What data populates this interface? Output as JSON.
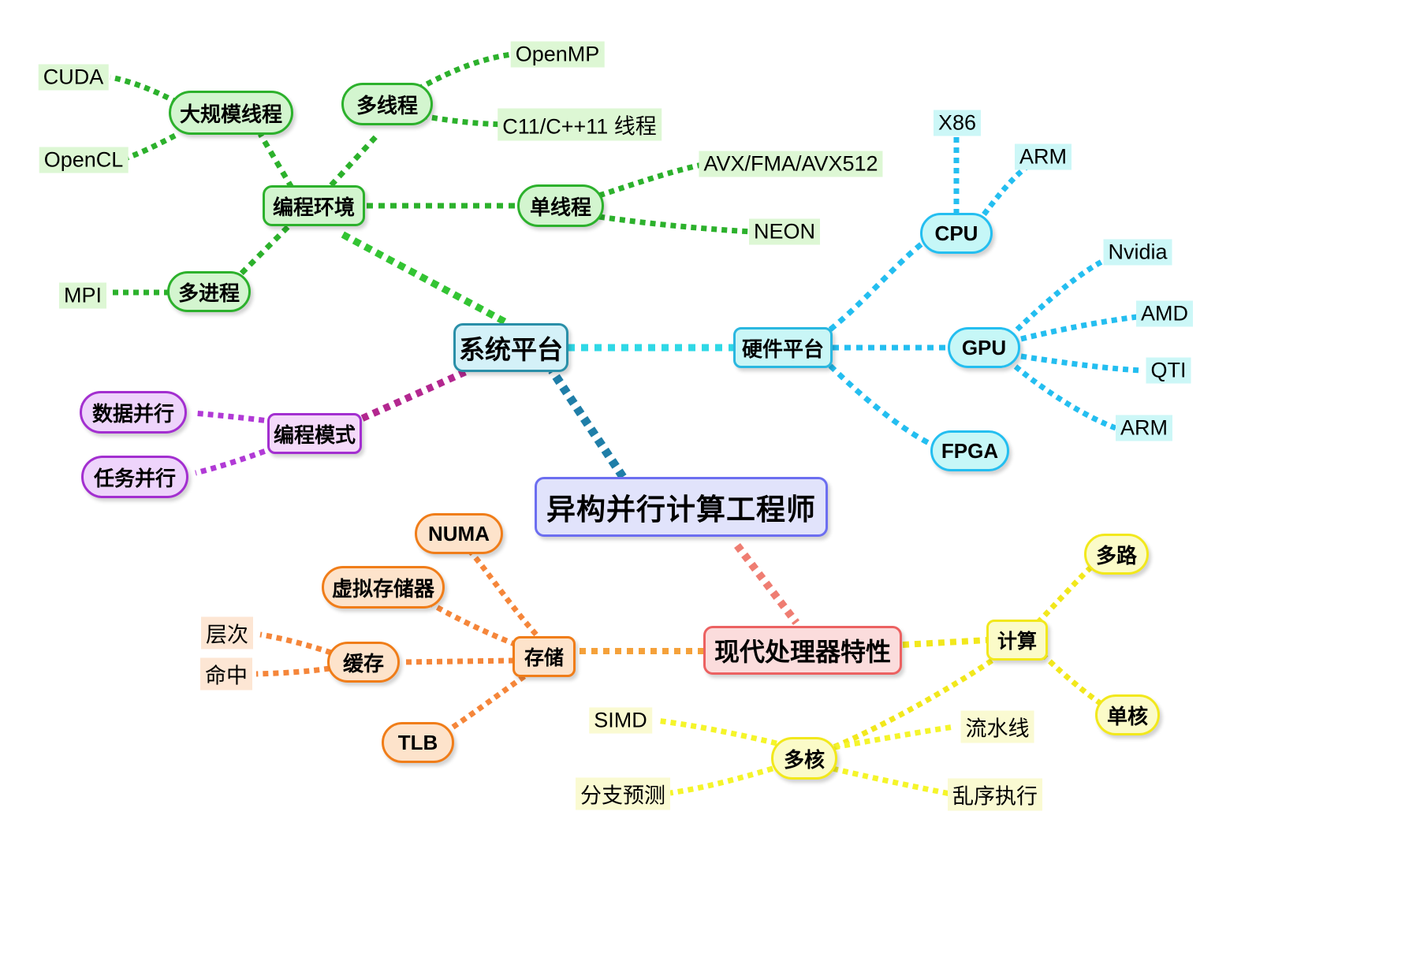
{
  "diagram": {
    "title": "异构并行计算工程师",
    "type": "mind-map",
    "background": "#ffffff"
  },
  "palette": {
    "root": "#6c6ef0",
    "system": "#2a8fa8",
    "programming_env": "#2cb12c",
    "programming_mode": "#a32fd0",
    "hardware": "#24bef0",
    "memory": "#f07d19",
    "processor": "#ec6161",
    "compute": "#f2e81c"
  },
  "root": {
    "label": "异构并行计算工程师"
  },
  "branches": {
    "system_platform": {
      "label": "系统平台",
      "programming_env": {
        "label": "编程环境",
        "children": [
          {
            "label": "大规模线程",
            "leaves": [
              "CUDA",
              "OpenCL"
            ]
          },
          {
            "label": "多线程",
            "leaves": [
              "OpenMP",
              "C11/C++11 线程"
            ]
          },
          {
            "label": "单线程",
            "leaves": [
              "AVX/FMA/AVX512",
              "NEON"
            ]
          },
          {
            "label": "多进程",
            "leaves": [
              "MPI"
            ]
          }
        ]
      },
      "hardware_platform": {
        "label": "硬件平台",
        "children": [
          {
            "label": "CPU",
            "leaves": [
              "X86",
              "ARM"
            ]
          },
          {
            "label": "GPU",
            "leaves": [
              "Nvidia",
              "AMD",
              "QTI",
              "ARM"
            ]
          },
          {
            "label": "FPGA",
            "leaves": []
          }
        ]
      },
      "programming_mode": {
        "label": "编程模式",
        "children": [
          {
            "label": "数据并行",
            "leaves": []
          },
          {
            "label": "任务并行",
            "leaves": []
          }
        ]
      }
    },
    "processor_features": {
      "label": "现代处理器特性",
      "memory": {
        "label": "存储",
        "children": [
          {
            "label": "NUMA",
            "leaves": []
          },
          {
            "label": "虚拟存储器",
            "leaves": []
          },
          {
            "label": "缓存",
            "leaves": [
              "层次",
              "命中"
            ]
          },
          {
            "label": "TLB",
            "leaves": []
          }
        ]
      },
      "compute": {
        "label": "计算",
        "children": [
          {
            "label": "多路",
            "leaves": []
          },
          {
            "label": "单核",
            "leaves": []
          },
          {
            "label": "多核",
            "leaves": [
              "SIMD",
              "流水线",
              "分支预测",
              "乱序执行"
            ]
          }
        ]
      }
    }
  },
  "nodes": {
    "root": "异构并行计算工程师",
    "system_platform": "系统平台",
    "programming_env": "编程环境",
    "massive_threads": "大规模线程",
    "cuda": "CUDA",
    "opencl": "OpenCL",
    "multithread": "多线程",
    "openmp": "OpenMP",
    "c11_threads": "C11/C++11 线程",
    "singlethread": "单线程",
    "avx": "AVX/FMA/AVX512",
    "neon": "NEON",
    "multiprocess": "多进程",
    "mpi": "MPI",
    "hardware_platform": "硬件平台",
    "cpu": "CPU",
    "x86": "X86",
    "arm_cpu": "ARM",
    "gpu": "GPU",
    "nvidia": "Nvidia",
    "amd": "AMD",
    "qti": "QTI",
    "arm_gpu": "ARM",
    "fpga": "FPGA",
    "programming_mode": "编程模式",
    "data_parallel": "数据并行",
    "task_parallel": "任务并行",
    "processor_features": "现代处理器特性",
    "memory": "存储",
    "numa": "NUMA",
    "virtual_memory": "虚拟存储器",
    "cache": "缓存",
    "cache_hierarchy": "层次",
    "cache_hit": "命中",
    "tlb": "TLB",
    "compute": "计算",
    "multiway": "多路",
    "singlecore": "单核",
    "multicore": "多核",
    "simd": "SIMD",
    "pipeline": "流水线",
    "branch_prediction": "分支预测",
    "ooo_execution": "乱序执行"
  }
}
